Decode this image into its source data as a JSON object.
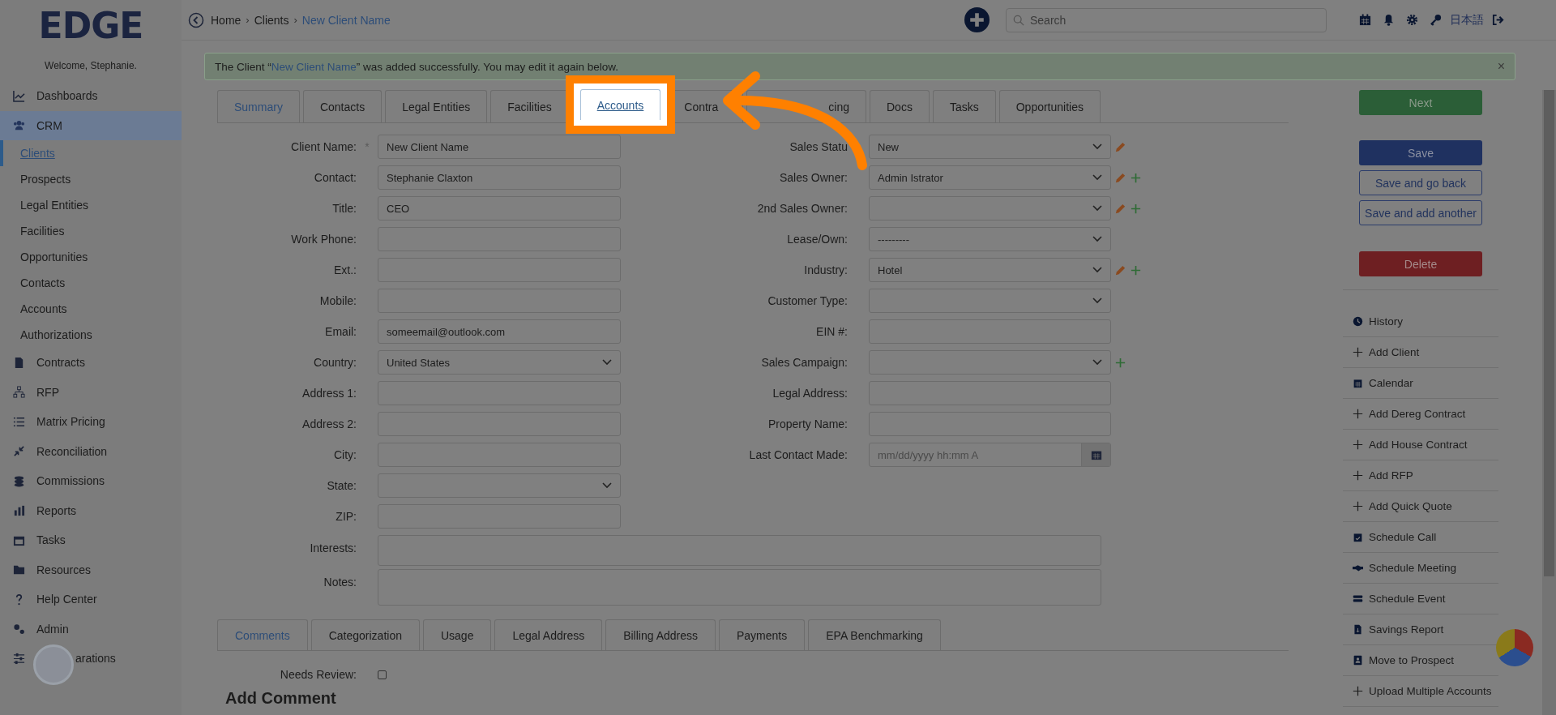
{
  "logo": "EDGE",
  "welcome": "Welcome, Stephanie.",
  "breadcrumb": [
    {
      "kind": "link",
      "label": "Home",
      "current": false
    },
    {
      "kind": "separator",
      "label": "›"
    },
    {
      "kind": "link",
      "label": "Clients",
      "current": false
    },
    {
      "kind": "separator",
      "label": "›"
    },
    {
      "kind": "link",
      "label": "New Client Name",
      "current": true
    }
  ],
  "search": {
    "placeholder": "Search"
  },
  "language": "日本語",
  "sidebar": {
    "items": [
      {
        "label": "Dashboards",
        "selected": false
      },
      {
        "label": "CRM",
        "selected": true,
        "expanded": true,
        "children": [
          {
            "label": "Clients",
            "selected": true
          },
          {
            "label": "Prospects",
            "selected": false
          },
          {
            "label": "Legal Entities",
            "selected": false
          },
          {
            "label": "Facilities",
            "selected": false
          },
          {
            "label": "Opportunities",
            "selected": false
          },
          {
            "label": "Contacts",
            "selected": false
          },
          {
            "label": "Accounts",
            "selected": false
          },
          {
            "label": "Authorizations",
            "selected": false
          }
        ]
      },
      {
        "label": "Contracts",
        "selected": false
      },
      {
        "label": "RFP",
        "selected": false
      },
      {
        "label": "Matrix Pricing",
        "selected": false
      },
      {
        "label": "Reconciliation",
        "selected": false
      },
      {
        "label": "Commissions",
        "selected": false
      },
      {
        "label": "Reports",
        "selected": false
      },
      {
        "label": "Tasks",
        "selected": false
      },
      {
        "label": "Resources",
        "selected": false
      },
      {
        "label": "Help Center",
        "selected": false
      },
      {
        "label": "Admin",
        "selected": false
      },
      {
        "label": "arations",
        "selected": false
      }
    ]
  },
  "alert": {
    "before": "The Client “",
    "link": "New Client Name",
    "after": "” was added successfully. You may edit it again below.",
    "close": "×"
  },
  "tabs": [
    {
      "label": "Summary",
      "selected": true,
      "spotlight": false
    },
    {
      "label": "Contacts",
      "selected": false,
      "spotlight": false
    },
    {
      "label": "Legal Entities",
      "selected": false,
      "spotlight": false
    },
    {
      "label": "Facilities",
      "selected": false,
      "spotlight": false
    },
    {
      "label": "Accounts",
      "selected": false,
      "spotlight": true
    },
    {
      "label": "Contra",
      "selected": false,
      "spotlight": false
    },
    {
      "label": "cing",
      "selected": false,
      "spotlight": false
    },
    {
      "label": "Docs",
      "selected": false,
      "spotlight": false
    },
    {
      "label": "Tasks",
      "selected": false,
      "spotlight": false
    },
    {
      "label": "Opportunities",
      "selected": false,
      "spotlight": false
    }
  ],
  "form": {
    "required_mark": "*",
    "left": [
      {
        "label": "Client Name:",
        "kind": "text",
        "value": "New Client Name",
        "required": true
      },
      {
        "label": "Contact:",
        "kind": "text",
        "value": "Stephanie Claxton",
        "required": false
      },
      {
        "label": "Title:",
        "kind": "text",
        "value": "CEO",
        "required": false
      },
      {
        "label": "Work Phone:",
        "kind": "text",
        "required": false
      },
      {
        "label": "Ext.:",
        "kind": "text",
        "required": false
      },
      {
        "label": "Mobile:",
        "kind": "text",
        "required": false
      },
      {
        "label": "Email:",
        "kind": "text",
        "value": "someemail@outlook.com",
        "required": false
      },
      {
        "label": "Country:",
        "kind": "select",
        "value": "United States",
        "required": false
      },
      {
        "label": "Address 1:",
        "kind": "text",
        "required": false
      },
      {
        "label": "Address 2:",
        "kind": "text",
        "required": false
      },
      {
        "label": "City:",
        "kind": "text",
        "required": false
      },
      {
        "label": "State:",
        "kind": "select",
        "required": false
      },
      {
        "label": "ZIP:",
        "kind": "text",
        "required": false
      }
    ],
    "right": [
      {
        "label": "Sales Statu",
        "kind": "select",
        "value": "New",
        "edit": true,
        "add": false
      },
      {
        "label": "Sales Owner:",
        "kind": "select",
        "value": "Admin Istrator",
        "edit": true,
        "add": true
      },
      {
        "label": "2nd Sales Owner:",
        "kind": "select",
        "edit": true,
        "add": true
      },
      {
        "label": "Lease/Own:",
        "kind": "select",
        "value": "---------",
        "edit": false,
        "add": false
      },
      {
        "label": "Industry:",
        "kind": "select",
        "value": "Hotel",
        "edit": true,
        "add": true
      },
      {
        "label": "Customer Type:",
        "kind": "select",
        "edit": false,
        "add": false
      },
      {
        "label": "EIN #:",
        "kind": "text",
        "edit": false,
        "add": false
      },
      {
        "label": "Sales Campaign:",
        "kind": "select",
        "edit": false,
        "add": true
      },
      {
        "label": "Legal Address:",
        "kind": "text",
        "edit": false,
        "add": false
      },
      {
        "label": "Property Name:",
        "kind": "text",
        "edit": false,
        "add": false
      },
      {
        "label": "Last Contact Made:",
        "kind": "datetime",
        "placeholder": "mm/dd/yyyy hh:mm A",
        "edit": false,
        "add": false
      }
    ],
    "wide": [
      {
        "label": "Interests:",
        "kind": "area"
      },
      {
        "label": "Notes:",
        "kind": "area"
      }
    ]
  },
  "bottom_tabs": [
    {
      "label": "Comments",
      "selected": true
    },
    {
      "label": "Categorization",
      "selected": false
    },
    {
      "label": "Usage",
      "selected": false
    },
    {
      "label": "Legal Address",
      "selected": false
    },
    {
      "label": "Billing Address",
      "selected": false
    },
    {
      "label": "Payments",
      "selected": false
    },
    {
      "label": "EPA Benchmarking",
      "selected": false
    }
  ],
  "needs_review": {
    "label": "Needs Review:",
    "checked": false
  },
  "add_comment": "Add Comment",
  "buttons": [
    {
      "label": "Next",
      "kind": "success"
    },
    {
      "label": "Save",
      "kind": "primary"
    },
    {
      "label": "Save and go back",
      "kind": "outline"
    },
    {
      "label": "Save and add another",
      "kind": "outline"
    },
    {
      "label": "Delete",
      "kind": "danger"
    }
  ],
  "actions": [
    {
      "label": "History"
    },
    {
      "label": "Add Client"
    },
    {
      "label": "Calendar"
    },
    {
      "label": "Add Dereg Contract"
    },
    {
      "label": "Add House Contract"
    },
    {
      "label": "Add RFP"
    },
    {
      "label": "Add Quick Quote"
    },
    {
      "label": "Schedule Call"
    },
    {
      "label": "Schedule Meeting"
    },
    {
      "label": "Schedule Event"
    },
    {
      "label": "Savings Report"
    },
    {
      "label": "Move to Prospect"
    },
    {
      "label": "Upload Multiple Accounts"
    }
  ]
}
